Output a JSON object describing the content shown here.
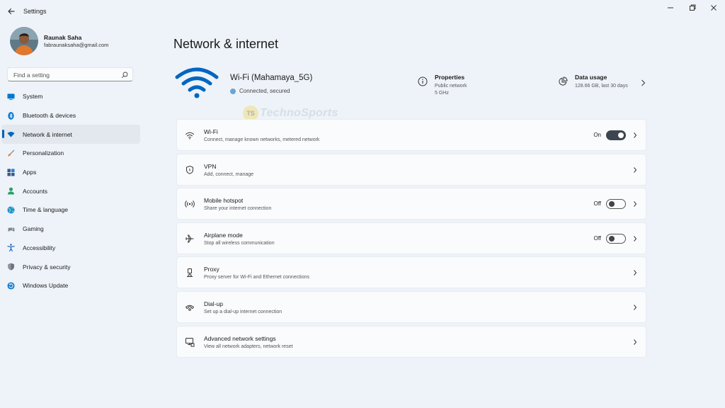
{
  "window": {
    "title": "Settings"
  },
  "user": {
    "name": "Raunak Saha",
    "email": "fabraunaksaha@gmail.com"
  },
  "search": {
    "placeholder": "Find a setting"
  },
  "sidebar": {
    "items": [
      {
        "label": "System",
        "icon": "monitor-icon",
        "color": "#0078d4"
      },
      {
        "label": "Bluetooth & devices",
        "icon": "bluetooth-icon",
        "color": "#0078d4"
      },
      {
        "label": "Network & internet",
        "icon": "wifi-icon",
        "color": "#0067c0",
        "active": true
      },
      {
        "label": "Personalization",
        "icon": "brush-icon",
        "color": "#e38a2f"
      },
      {
        "label": "Apps",
        "icon": "apps-icon",
        "color": "#3a5a85"
      },
      {
        "label": "Accounts",
        "icon": "person-icon",
        "color": "#2aa166"
      },
      {
        "label": "Time & language",
        "icon": "globe-icon",
        "color": "#1f8fd6"
      },
      {
        "label": "Gaming",
        "icon": "gamepad-icon",
        "color": "#7a8894"
      },
      {
        "label": "Accessibility",
        "icon": "accessibility-icon",
        "color": "#1769b8"
      },
      {
        "label": "Privacy & security",
        "icon": "shield-icon",
        "color": "#8d96a0"
      },
      {
        "label": "Windows Update",
        "icon": "update-icon",
        "color": "#1a7fd1"
      }
    ]
  },
  "main": {
    "title": "Network & internet",
    "connection": {
      "name": "Wi-Fi (Mahamaya_5G)",
      "status": "Connected, secured"
    },
    "properties": {
      "title": "Properties",
      "line1": "Public network",
      "line2": "5 GHz"
    },
    "data_usage": {
      "title": "Data usage",
      "line1": "128.66 GB, last 30 days"
    },
    "watermark": {
      "logo": "TS",
      "text": "TechnoSports"
    },
    "cards": [
      {
        "title": "Wi-Fi",
        "sub": "Connect, manage known networks, metered network",
        "icon": "wifi-icon",
        "toggle": "On"
      },
      {
        "title": "VPN",
        "sub": "Add, connect, manage",
        "icon": "vpn-shield-icon"
      },
      {
        "title": "Mobile hotspot",
        "sub": "Share your internet connection",
        "icon": "hotspot-icon",
        "toggle": "Off"
      },
      {
        "title": "Airplane mode",
        "sub": "Stop all wireless communication",
        "icon": "airplane-icon",
        "toggle": "Off"
      },
      {
        "title": "Proxy",
        "sub": "Proxy server for Wi-Fi and Ethernet connections",
        "icon": "proxy-icon"
      },
      {
        "title": "Dial-up",
        "sub": "Set up a dial-up internet connection",
        "icon": "dialup-icon"
      },
      {
        "title": "Advanced network settings",
        "sub": "View all network adapters, network reset",
        "icon": "advanced-network-icon"
      }
    ]
  },
  "colors": {
    "accent": "#005fb8",
    "hero_wifi": "#0067c0",
    "background": "#eef3f9"
  }
}
